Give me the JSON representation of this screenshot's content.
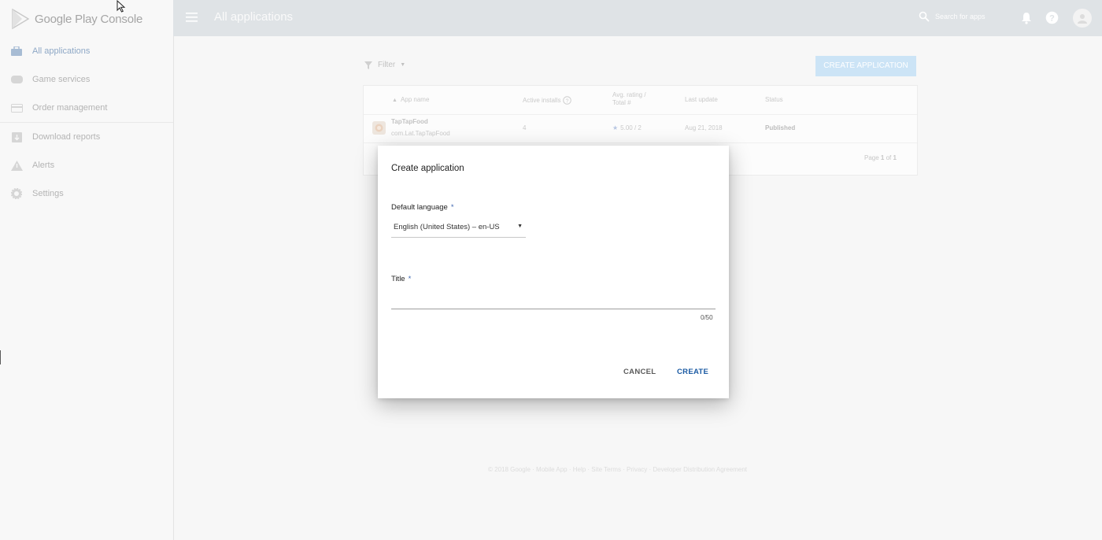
{
  "brand": {
    "name": "Google Play Console"
  },
  "sidebar": {
    "items": [
      {
        "label": "All applications",
        "icon": "apps-icon",
        "active": true
      },
      {
        "label": "Game services",
        "icon": "gamepad-icon"
      },
      {
        "label": "Order management",
        "icon": "credit-card-icon"
      },
      {
        "label": "Download reports",
        "icon": "download-icon"
      },
      {
        "label": "Alerts",
        "icon": "warning-icon"
      },
      {
        "label": "Settings",
        "icon": "gear-icon"
      }
    ]
  },
  "topbar": {
    "title": "All applications",
    "search_placeholder": "Search for apps"
  },
  "main": {
    "filter_label": "Filter",
    "create_button": "CREATE APPLICATION",
    "table": {
      "headers": {
        "app_name": "App name",
        "active_installs": "Active installs",
        "rating_line1": "Avg. rating /",
        "rating_line2": "Total #",
        "last_update": "Last update",
        "status": "Status"
      },
      "rows": [
        {
          "name": "TapTapFood",
          "package": "com.Lat.TapTapFood",
          "installs": "4",
          "rating": "5.00 / 2",
          "updated": "Aug 21, 2018",
          "status": "Published"
        }
      ],
      "pagination": {
        "prefix": "Page",
        "current": "1",
        "of": "of",
        "total": "1"
      }
    },
    "footer": "© 2018 Google · Mobile App · Help · Site Terms · Privacy · Developer Distribution Agreement"
  },
  "dialog": {
    "title": "Create application",
    "language_label": "Default language",
    "required_mark": "*",
    "language_value": "English (United States) – en-US",
    "title_label": "Title",
    "title_value": "",
    "counter": "0/50",
    "cancel": "CANCEL",
    "create": "CREATE"
  },
  "colors": {
    "accent": "#1a5aa3",
    "required": "#3f67b0",
    "topbar": "#dfe3e6",
    "create_app_button": "#cce4f6"
  }
}
